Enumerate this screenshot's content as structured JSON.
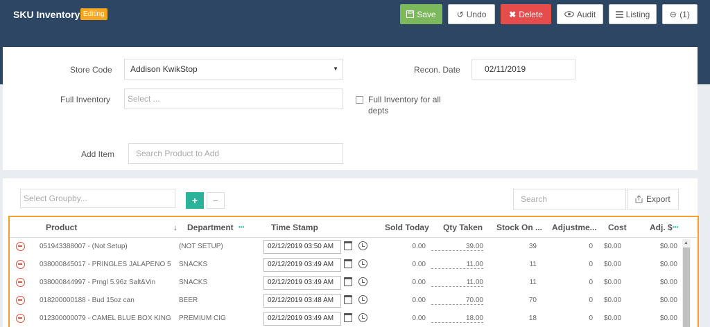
{
  "header": {
    "title": "SKU Inventory",
    "badge": "Editing"
  },
  "toolbar": {
    "save": "Save",
    "undo": "Undo",
    "delete": "Delete",
    "audit": "Audit",
    "listing": "Listing",
    "attachments": "(1)"
  },
  "form": {
    "store_code_label": "Store Code",
    "store_code_value": "Addison KwikStop",
    "recon_date_label": "Recon. Date",
    "recon_date_value": "02/11/2019",
    "full_inventory_label": "Full Inventory",
    "full_inventory_placeholder": "Select ...",
    "full_inventory_all_label_1": "Full Inventory for all",
    "full_inventory_all_label_2": "depts",
    "add_item_label": "Add Item",
    "add_item_placeholder": "Search Product to Add"
  },
  "grid_toolbar": {
    "groupby_placeholder": "Select Groupby...",
    "add": "+",
    "remove": "−",
    "search_placeholder": "Search",
    "export": "Export"
  },
  "columns": {
    "product": "Product",
    "sort_arrow": "↓",
    "department": "Department",
    "dept_menu": "•••",
    "timestamp": "Time Stamp",
    "sold_today": "Sold Today",
    "qty_taken": "Qty Taken",
    "stock_on": "Stock On ...",
    "adjustment": "Adjustme...",
    "cost": "Cost",
    "adj_dollar": "Adj. $",
    "adj_menu": "•••"
  },
  "rows": [
    {
      "product": "051943388007 - (Not Setup)",
      "department": "(NOT SETUP)",
      "timestamp": "02/12/2019 03:50 AM",
      "sold_today": "0.00",
      "qty_taken": "39.00",
      "stock_on": "39",
      "adjustment": "0",
      "cost": "$0.00",
      "adj_dollar": "$0.00"
    },
    {
      "product": "038000845017 - PRINGLES JALAPENO 5....",
      "department": "SNACKS",
      "timestamp": "02/12/2019 03:49 AM",
      "sold_today": "0.00",
      "qty_taken": "11.00",
      "stock_on": "11",
      "adjustment": "0",
      "cost": "$0.00",
      "adj_dollar": "$0.00"
    },
    {
      "product": "038000844997 - Prngl 5.96z Salt&Vin",
      "department": "SNACKS",
      "timestamp": "02/12/2019 03:49 AM",
      "sold_today": "0.00",
      "qty_taken": "11.00",
      "stock_on": "11",
      "adjustment": "0",
      "cost": "$0.00",
      "adj_dollar": "$0.00"
    },
    {
      "product": "018200000188 - Bud 15oz can",
      "department": "BEER",
      "timestamp": "02/12/2019 03:48 AM",
      "sold_today": "0.00",
      "qty_taken": "70.00",
      "stock_on": "70",
      "adjustment": "0",
      "cost": "$0.00",
      "adj_dollar": "$0.00"
    },
    {
      "product": "012300000079 - CAMEL BLUE BOX KING...",
      "department": "PREMIUM CIG",
      "timestamp": "02/12/2019 03:49 AM",
      "sold_today": "0.00",
      "qty_taken": "18.00",
      "stock_on": "18",
      "adjustment": "0",
      "cost": "$0.00",
      "adj_dollar": "$0.00"
    }
  ]
}
